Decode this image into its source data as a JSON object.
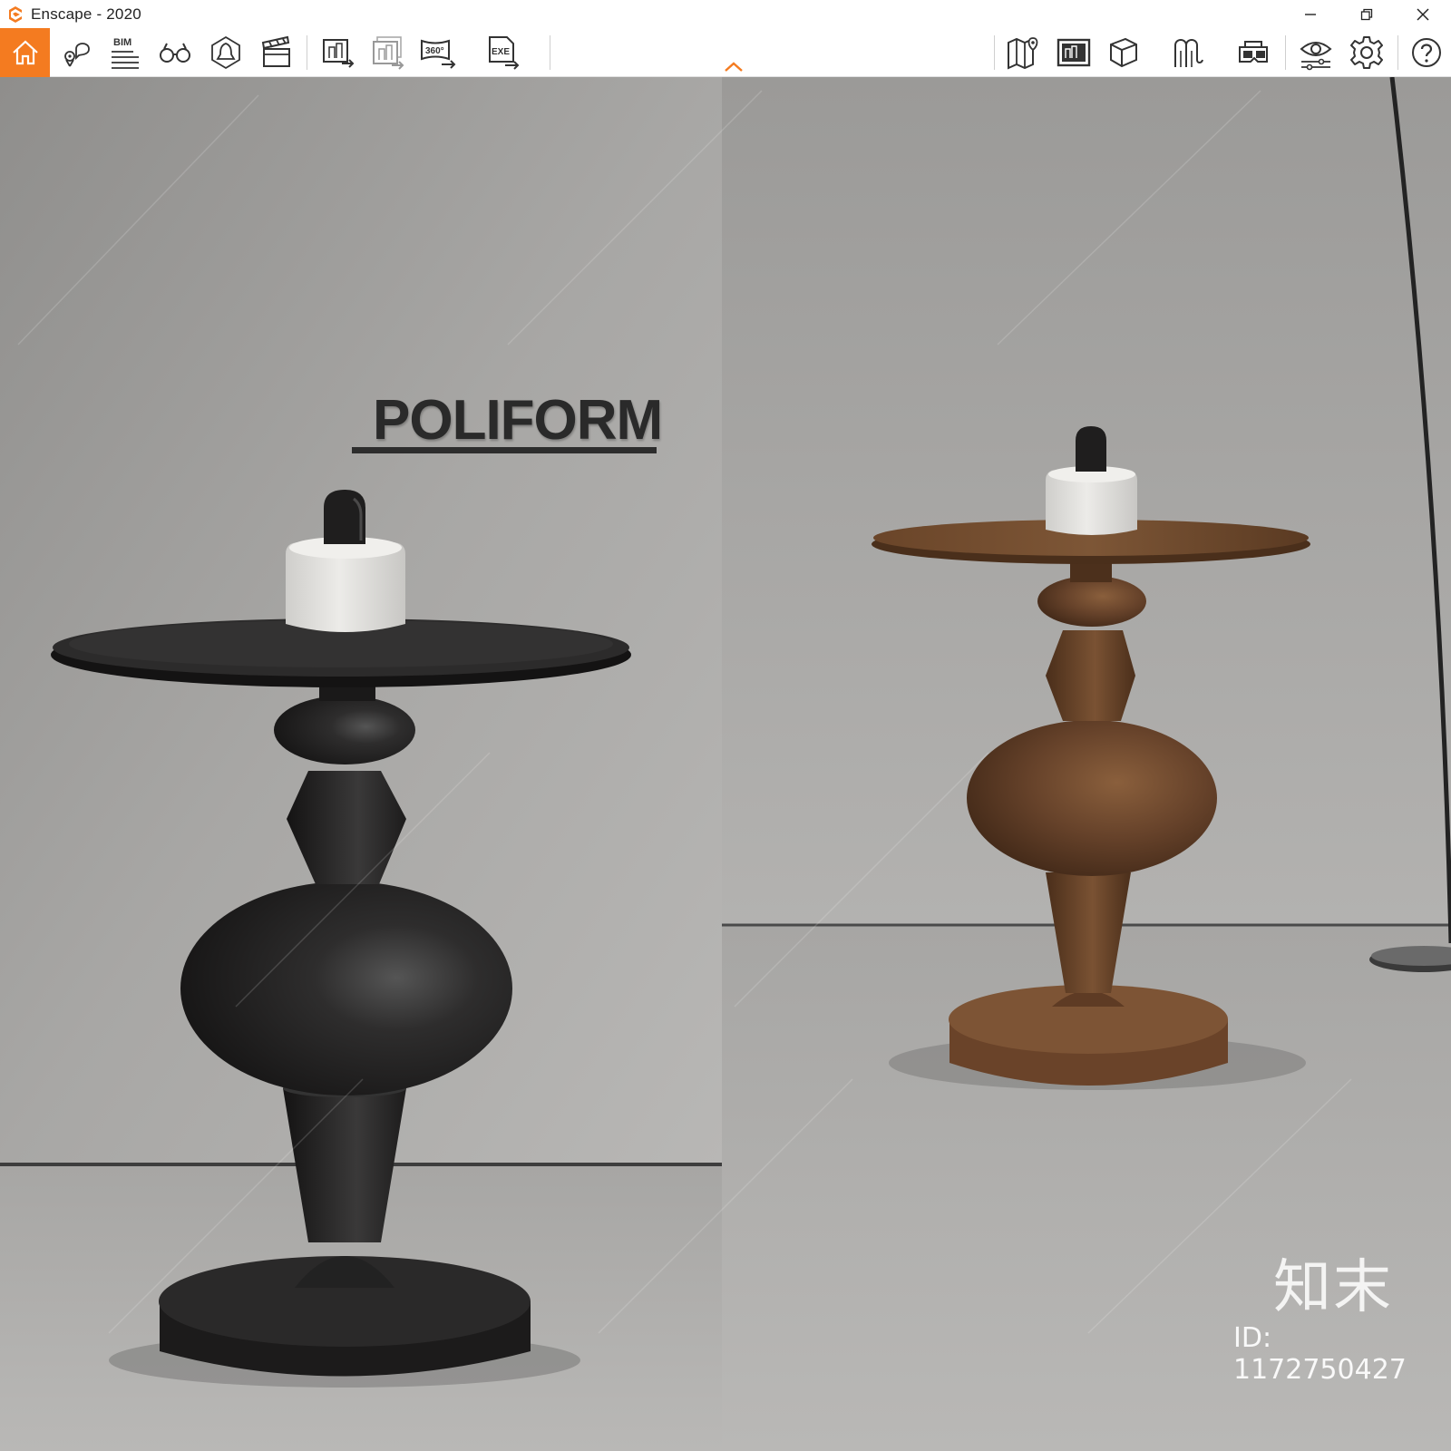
{
  "window": {
    "title": "Enscape - 2020"
  },
  "toolbar": {
    "left_tools": [
      {
        "icon": "home-icon"
      },
      {
        "icon": "location-marker-icon"
      },
      {
        "icon": "bim-icon",
        "label": "BIM"
      },
      {
        "icon": "binoculars-icon"
      },
      {
        "icon": "bell-asset-icon"
      },
      {
        "icon": "clapperboard-icon"
      },
      {
        "icon": "screenshot-export-icon"
      },
      {
        "icon": "batch-render-icon"
      },
      {
        "icon": "panorama-360-icon",
        "label": "360°"
      },
      {
        "icon": "exe-export-icon",
        "label": "EXE"
      }
    ],
    "right_tools": [
      {
        "icon": "map-icon"
      },
      {
        "icon": "view-management-icon"
      },
      {
        "icon": "cube-icon"
      },
      {
        "icon": "section-icon"
      },
      {
        "icon": "vr-headset-icon"
      },
      {
        "icon": "eye-settings-icon"
      },
      {
        "icon": "gear-icon"
      },
      {
        "icon": "help-icon"
      }
    ]
  },
  "scene": {
    "brand_text": "POLIFORM",
    "watermark_logo": "知末",
    "watermark_id": "ID: 1172750427"
  },
  "colors": {
    "accent": "#f47b20",
    "wall": "#a9a8a6",
    "floor": "#b2b1af",
    "black_table": "#262525",
    "wood_table": "#5b3a22",
    "marble": "#e4e3e0"
  }
}
